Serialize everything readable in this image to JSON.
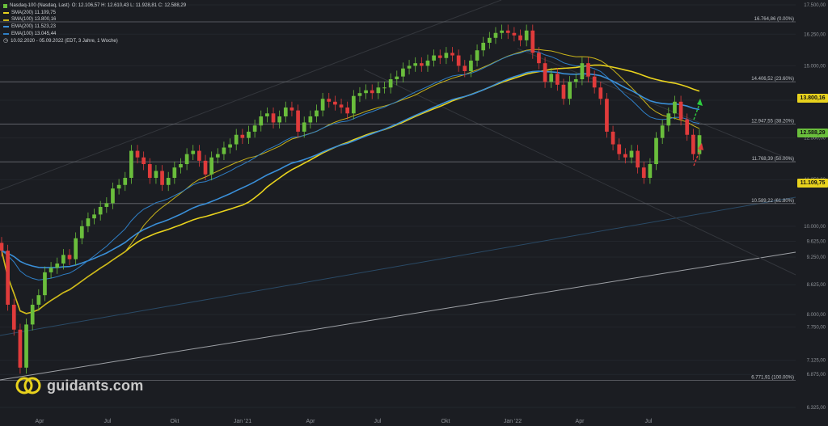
{
  "legend": {
    "title": "Nasdaq-100 (Nasdaq, Last)",
    "ohlc": "O: 12.106,57  H: 12.610,43  L: 11.928,81  C: 12.588,29",
    "items": [
      {
        "label": "SMA(200)  11.109,75",
        "color": "#e8d21d"
      },
      {
        "label": "SMA(100)  13.800,16",
        "color": "#c9b41a"
      },
      {
        "label": "EMA(200)  11.523,23",
        "color": "#3a8fd8"
      },
      {
        "label": "EMA(100)  13.045,44",
        "color": "#2f7fc6"
      }
    ],
    "range": "10.02.2020 - 05.09.2022  (EDT, 3 Jahre, 1 Woche)"
  },
  "watermark": "guidants.com",
  "colors": {
    "up": "#6abe3c",
    "down": "#e03b3b",
    "sma200": "#e8d21d",
    "sma100": "#c9b41a",
    "ema200": "#3a8fd8",
    "ema100": "#2f7fc6",
    "fib": "#6a6d73",
    "label": "#bfc3c8"
  },
  "chart_data": {
    "type": "candlestick",
    "y_axis": {
      "ticks": [
        17500,
        16250,
        15000,
        13750,
        12500,
        11250,
        10000,
        9625,
        9250,
        8625,
        8000,
        7750,
        7125,
        6875,
        6325
      ],
      "tick_labels": [
        "17.500,00",
        "16.250,00",
        "15.000,00",
        "13.750,00",
        "12.500,00",
        "11.250,00",
        "10.000,00",
        "9.625,00",
        "9.250,00",
        "8.625,00",
        "8.000,00",
        "7.750,00",
        "7.125,00",
        "6.875,00",
        "6.325,00"
      ],
      "scale": "log"
    },
    "x_axis": {
      "labels": [
        "Apr",
        "Jul",
        "Okt",
        "Jan '21",
        "Apr",
        "Jul",
        "Okt",
        "Jan '22",
        "Apr",
        "Jul"
      ]
    },
    "fib_levels": [
      {
        "label": "16.764,86 (0.00%)",
        "value": 16764.86
      },
      {
        "label": "14.406,52 (23.60%)",
        "value": 14406.52
      },
      {
        "label": "12.947,55 (38.20%)",
        "value": 12947.55
      },
      {
        "label": "11.768,39 (50.00%)",
        "value": 11768.39
      },
      {
        "label": "10.589,22 (61.80%)",
        "value": 10589.22
      },
      {
        "label": "6.771,91 (100.00%)",
        "value": 6771.91
      }
    ],
    "price_badges": [
      {
        "label": "13.800,16",
        "value": 13800.16,
        "color": "#e8d21d"
      },
      {
        "label": "12.588,29",
        "value": 12588.29,
        "color": "#6abe3c"
      },
      {
        "label": "11.109,75",
        "value": 11109.75,
        "color": "#e8d21d"
      }
    ],
    "weekly_closes": [
      9400,
      8200,
      7700,
      6994,
      7800,
      8200,
      8400,
      8900,
      9000,
      9100,
      9300,
      9200,
      9700,
      10000,
      10200,
      10300,
      10500,
      10600,
      11000,
      11100,
      11300,
      12100,
      11900,
      11700,
      11300,
      11500,
      11100,
      11300,
      11600,
      11700,
      12000,
      12100,
      11800,
      11400,
      11900,
      12000,
      12200,
      12300,
      12600,
      12500,
      12700,
      12900,
      13200,
      13300,
      13000,
      13200,
      13500,
      13400,
      12700,
      13000,
      13200,
      13400,
      13800,
      13700,
      13600,
      13500,
      13300,
      13900,
      14000,
      14100,
      14000,
      14200,
      14200,
      14500,
      14600,
      14900,
      15000,
      15100,
      15000,
      15200,
      15400,
      15300,
      15500,
      15400,
      15000,
      14800,
      15200,
      15600,
      15900,
      16100,
      16300,
      16400,
      16300,
      16200,
      16000,
      16400,
      15500,
      15100,
      14400,
      14700,
      14300,
      13800,
      14400,
      14500,
      15100,
      14600,
      14200,
      13800,
      12700,
      12300,
      12000,
      11900,
      12100,
      11600,
      11300,
      11700,
      12500,
      12900,
      13300,
      13700,
      13100,
      12600,
      12000,
      12588
    ]
  }
}
